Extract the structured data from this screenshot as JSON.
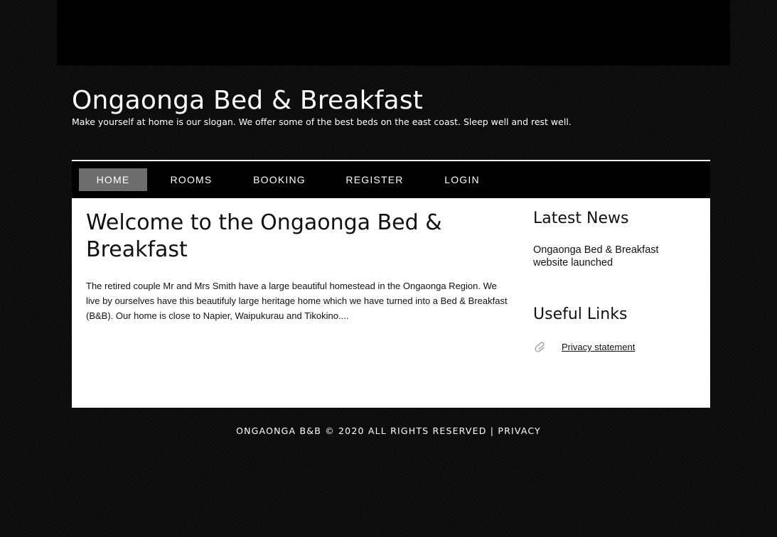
{
  "header": {
    "site_title": "Ongaonga Bed & Breakfast",
    "slogan": "Make yourself at home is our slogan. We offer some of the best beds on the east coast. Sleep well and rest well."
  },
  "nav": {
    "items": [
      {
        "label": "HOME",
        "active": true
      },
      {
        "label": "ROOMS",
        "active": false
      },
      {
        "label": "BOOKING",
        "active": false
      },
      {
        "label": "REGISTER",
        "active": false
      },
      {
        "label": "LOGIN",
        "active": false
      }
    ]
  },
  "main": {
    "heading": "Welcome to the Ongaonga Bed & Breakfast",
    "intro": "The retired couple Mr and Mrs Smith have a large beautiful homestead in the Ongaonga Region. We live by ourselves have this beautifuly large heritage home which we have turned into a Bed & Breakfast (B&B). Our home is close to Napier, Waipukurau and Tikokino...."
  },
  "sidebar": {
    "news_heading": "Latest News",
    "news_item": "Ongaonga Bed & Breakfast website launched",
    "links_heading": "Useful Links",
    "links": [
      {
        "label": "Privacy statement",
        "icon": "paperclip-icon"
      }
    ]
  },
  "footer": {
    "copyright": "ONGAONGA B&B © 2020 ALL RIGHTS RESERVED",
    "separator": "|",
    "privacy_label": "PRIVACY"
  },
  "colors": {
    "page_background": "#0b0b0b",
    "header_background": "#000000",
    "nav_active": "#6e6e6e",
    "content_background": "#ffffff",
    "text_dark": "#111111",
    "text_light": "#ffffff"
  }
}
